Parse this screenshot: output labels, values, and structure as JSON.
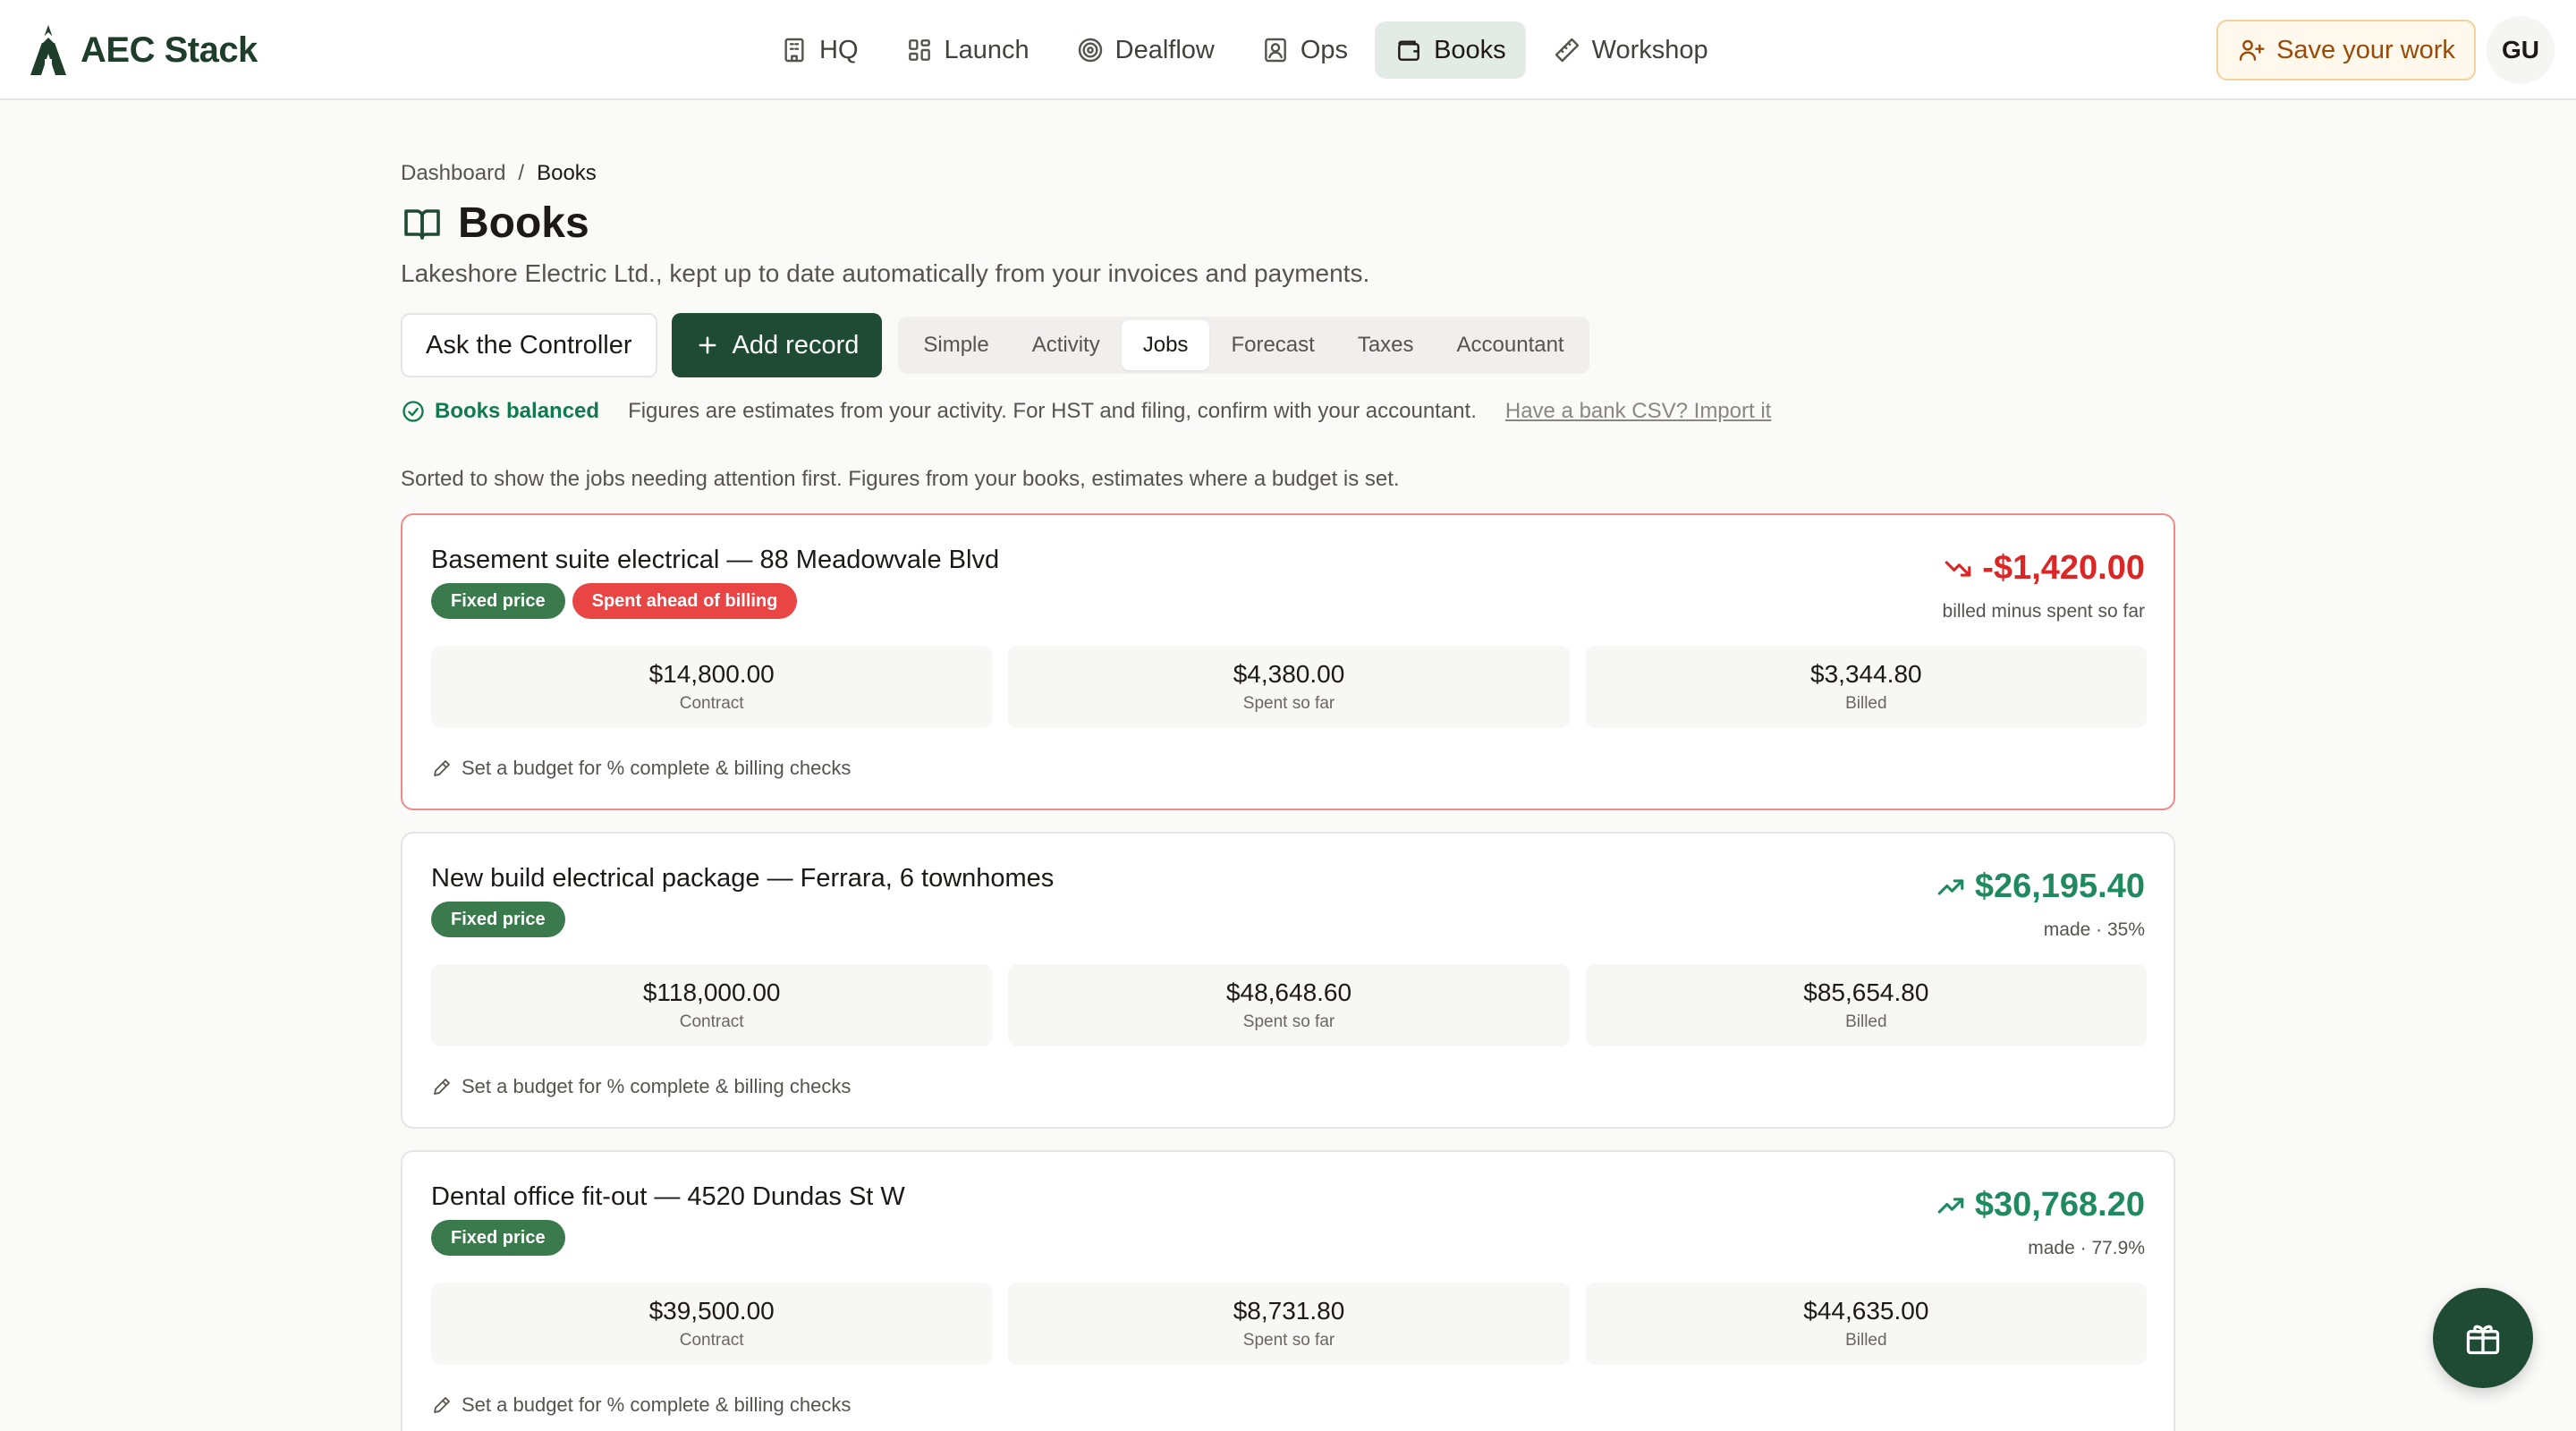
{
  "brand": {
    "name": "AEC Stack",
    "icon": "aec-stack-logo"
  },
  "nav": {
    "items": [
      {
        "label": "HQ",
        "icon": "building-icon"
      },
      {
        "label": "Launch",
        "icon": "grid-icon"
      },
      {
        "label": "Dealflow",
        "icon": "target-icon"
      },
      {
        "label": "Ops",
        "icon": "contact-icon"
      },
      {
        "label": "Books",
        "icon": "wallet-icon",
        "active": true
      },
      {
        "label": "Workshop",
        "icon": "ruler-icon"
      }
    ]
  },
  "header_actions": {
    "save_label": "Save your work",
    "avatar_initials": "GU"
  },
  "breadcrumb": {
    "root": "Dashboard",
    "separator": "/",
    "current": "Books"
  },
  "page": {
    "title": "Books",
    "subtitle": "Lakeshore Electric Ltd., kept up to date automatically from your invoices and payments."
  },
  "actions": {
    "ask_label": "Ask the Controller",
    "add_label": "Add record"
  },
  "tabs": [
    {
      "label": "Simple"
    },
    {
      "label": "Activity"
    },
    {
      "label": "Jobs",
      "active": true
    },
    {
      "label": "Forecast"
    },
    {
      "label": "Taxes"
    },
    {
      "label": "Accountant"
    }
  ],
  "status": {
    "balanced": "Books balanced",
    "note": "Figures are estimates from your activity. For HST and filing, confirm with your accountant.",
    "import_link": "Have a bank CSV? Import it"
  },
  "sort_note": "Sorted to show the jobs needing attention first. Figures from your books, estimates where a budget is set.",
  "jobs": [
    {
      "title": "Basement suite electrical — 88 Meadowvale Blvd",
      "badges": [
        "Fixed price",
        "Spent ahead of billing"
      ],
      "profit": "-$1,420.00",
      "profit_caption": "billed minus spent so far",
      "trend": "down",
      "contract": "$14,800.00",
      "spent": "$4,380.00",
      "billed": "$3,344.80",
      "budget_link": "Set a budget for % complete & billing checks"
    },
    {
      "title": "New build electrical package — Ferrara, 6 townhomes",
      "badges": [
        "Fixed price"
      ],
      "profit": "$26,195.40",
      "profit_caption": "made · 35%",
      "trend": "up",
      "contract": "$118,000.00",
      "spent": "$48,648.60",
      "billed": "$85,654.80",
      "budget_link": "Set a budget for % complete & billing checks"
    },
    {
      "title": "Dental office fit-out — 4520 Dundas St W",
      "badges": [
        "Fixed price"
      ],
      "profit": "$30,768.20",
      "profit_caption": "made · 77.9%",
      "trend": "up",
      "contract": "$39,500.00",
      "spent": "$8,731.80",
      "billed": "$44,635.00",
      "budget_link": "Set a budget for % complete & billing checks"
    }
  ],
  "stat_labels": {
    "contract": "Contract",
    "spent": "Spent so far",
    "billed": "Billed"
  },
  "colors": {
    "brand": "#1f4a34",
    "negative": "#dc2626",
    "positive": "#1f8a5f",
    "accent_warn": "#9a4a06"
  },
  "fab": {
    "icon": "gift-icon"
  }
}
